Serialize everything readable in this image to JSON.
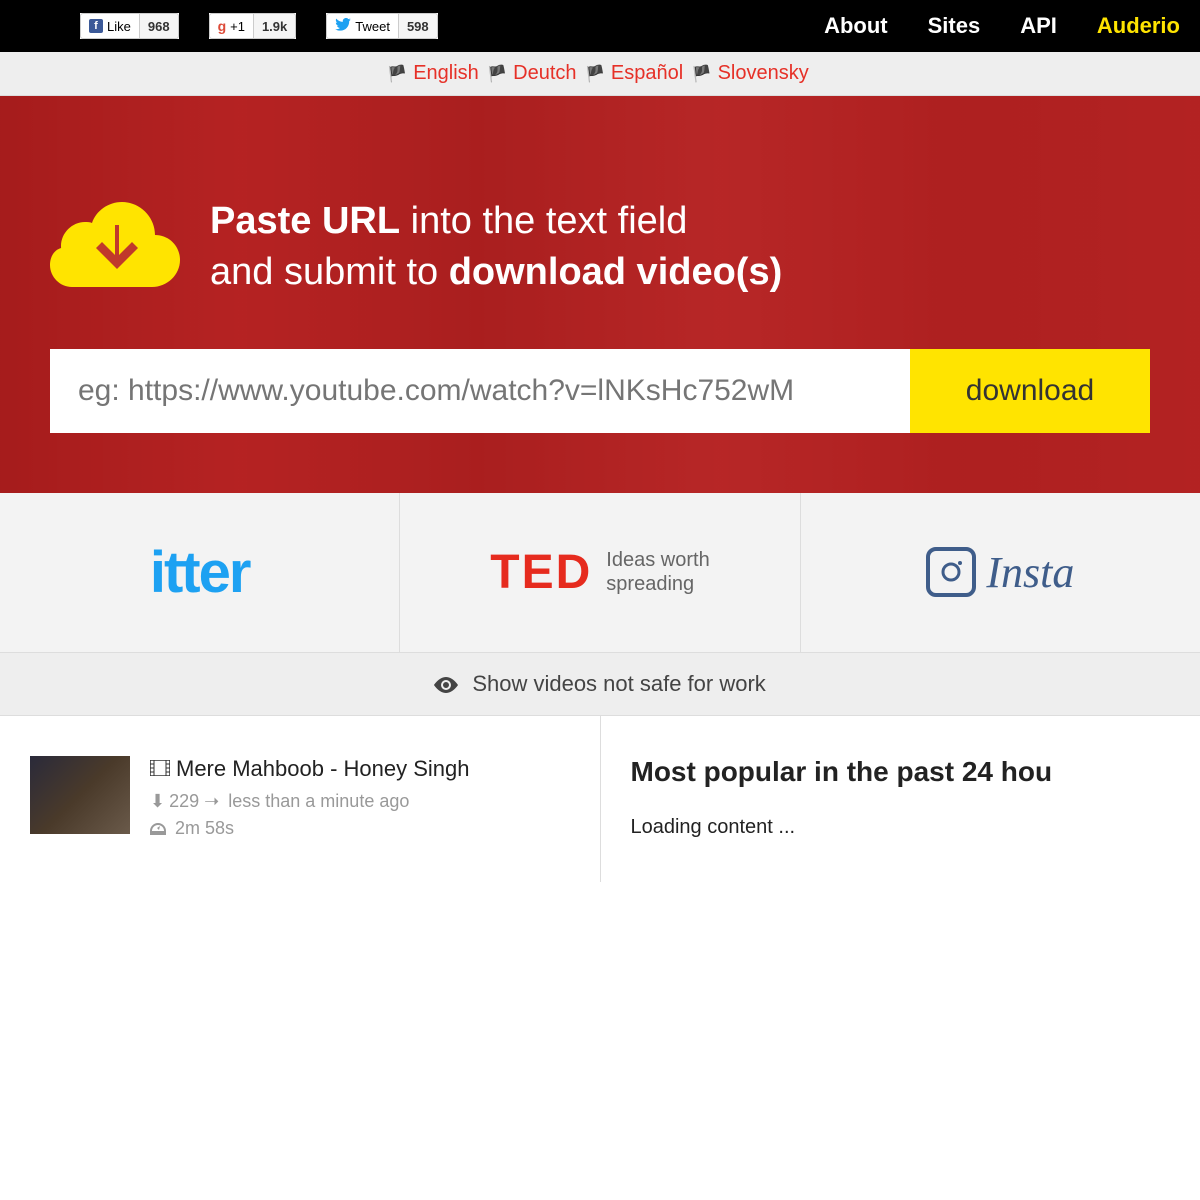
{
  "topbar": {
    "social": {
      "fb_label": "Like",
      "fb_count": "968",
      "g_label": "+1",
      "g_count": "1.9k",
      "tw_label": "Tweet",
      "tw_count": "598"
    },
    "nav": {
      "about": "About",
      "sites": "Sites",
      "api": "API",
      "auderio": "Auderio"
    }
  },
  "languages": {
    "english": "English",
    "deutch": "Deutch",
    "espanol": "Español",
    "slovensky": "Slovensky"
  },
  "hero": {
    "line1_bold": "Paste URL",
    "line1_rest": " into the text field",
    "line2_start": "and submit to ",
    "line2_bold": "download video(s)",
    "placeholder": "eg: https://www.youtube.com/watch?v=lNKsHc752wM",
    "button": "download"
  },
  "logos": {
    "twitter": "itter",
    "ted": "TED",
    "ted_tagline_1": "Ideas worth",
    "ted_tagline_2": "spreading",
    "instagram": "Insta"
  },
  "nsfw": {
    "label": "Show videos not safe for work"
  },
  "left": {
    "video": {
      "title": "Mere Mahboob - Honey Singh",
      "downloads": "229",
      "time_ago": "less than a minute ago",
      "duration": "2m 58s"
    }
  },
  "right": {
    "heading": "Most popular in the past 24 hou",
    "loading": "Loading content ..."
  }
}
